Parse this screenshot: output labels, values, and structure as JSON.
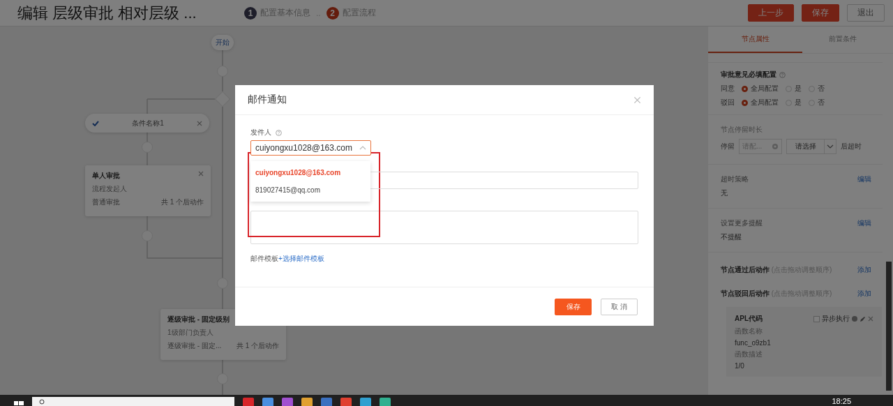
{
  "header": {
    "title": "编辑 层级审批 相对层级 ...",
    "step_separator": "..",
    "steps": [
      {
        "number": "1",
        "label": "配置基本信息",
        "selected": false
      },
      {
        "number": "2",
        "label": "配置流程",
        "selected": true
      }
    ],
    "buttons": [
      {
        "label": "上一步",
        "kind": "primary"
      },
      {
        "label": "保存",
        "kind": "primary"
      },
      {
        "label": "退出",
        "kind": "default"
      }
    ]
  },
  "flow": {
    "start": "开始",
    "condition": {
      "label": "条件名称1",
      "checked": true
    },
    "nodes": [
      {
        "title": "单人审批",
        "assignee": "流程发起人",
        "type": "普通审批",
        "actions": "共 1 个后动作"
      },
      {
        "title": "逐级审批 - 固定级别",
        "assignee": "1级部门负责人",
        "type": "逐级审批 - 固定...",
        "actions": "共 1 个后动作"
      }
    ]
  },
  "panel": {
    "tabs": [
      {
        "label": "节点属性",
        "selected": true
      },
      {
        "label": "前置条件",
        "selected": false
      }
    ],
    "opinion": {
      "title": "审批意见必填配置",
      "rows": [
        {
          "label": "同意",
          "options": [
            {
              "label": "全局配置",
              "selected": true
            },
            {
              "label": "是",
              "selected": false
            },
            {
              "label": "否",
              "selected": false
            }
          ]
        },
        {
          "label": "驳回",
          "options": [
            {
              "label": "全局配置",
              "selected": true
            },
            {
              "label": "是",
              "selected": false
            },
            {
              "label": "否",
              "selected": false
            }
          ]
        }
      ]
    },
    "stay": {
      "title": "节点停留时长",
      "prefix": "停留",
      "placeholder": "请配...",
      "select": "请选择",
      "suffix": "后超时"
    },
    "settings": [
      {
        "title": "超时策略",
        "value": "无",
        "action": "编辑"
      },
      {
        "title": "设置更多提醒",
        "value": "不提醒",
        "action": "编辑"
      }
    ],
    "actions": [
      {
        "title": "节点通过后动作",
        "hint": "(点击拖动调整顺序)",
        "action": "添加"
      },
      {
        "title": "节点驳回后动作",
        "hint": "(点击拖动调整顺序)",
        "action": "添加"
      }
    ],
    "apl_card": {
      "title": "APL代码",
      "async_label": "异步执行",
      "async_checked": false,
      "fields": [
        {
          "label": "函数名称",
          "value": "func_o9zb1"
        },
        {
          "label": "函数描述",
          "value": "1/0"
        }
      ]
    }
  },
  "dialog": {
    "title": "邮件通知",
    "sender": {
      "label": "发件人",
      "value": "cuiyongxu1028@163.com",
      "expanded": true,
      "options": [
        {
          "label": "cuiyongxu1028@163.com",
          "selected": true
        },
        {
          "label": "819027415@qq.com",
          "selected": false
        }
      ]
    },
    "template_label": "邮件模板",
    "template_link": "+选择邮件模板",
    "buttons": [
      {
        "label": "保存",
        "kind": "primary"
      },
      {
        "label": "取 消",
        "kind": "default"
      }
    ]
  },
  "taskbar": {
    "time": "18:25"
  }
}
